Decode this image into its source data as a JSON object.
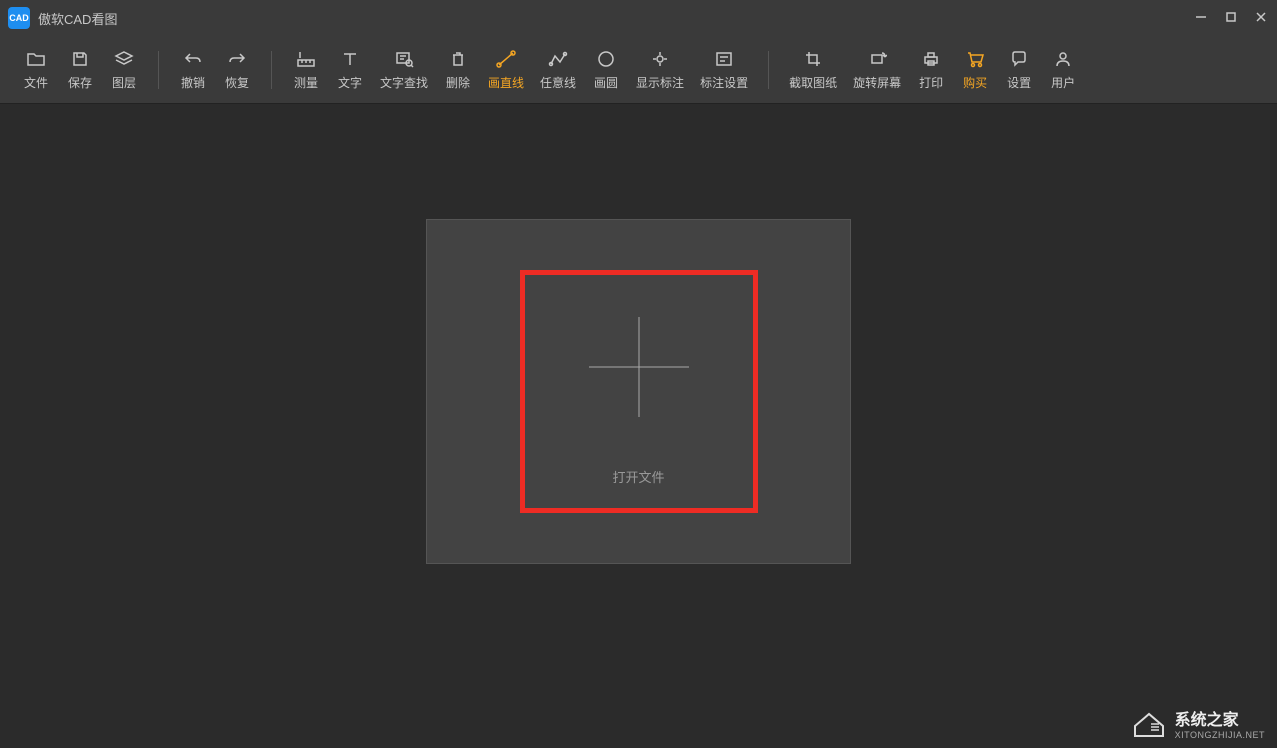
{
  "app": {
    "title": "傲软CAD看图",
    "icon_text": "CAD"
  },
  "toolbar": {
    "file": "文件",
    "save": "保存",
    "layers": "图层",
    "undo": "撤销",
    "redo": "恢复",
    "measure": "测量",
    "text": "文字",
    "text_search": "文字查找",
    "delete": "删除",
    "line": "画直线",
    "polyline": "任意线",
    "circle": "画圆",
    "show_annotations": "显示标注",
    "annotation_settings": "标注设置",
    "crop": "截取图纸",
    "rotate": "旋转屏幕",
    "print": "打印",
    "purchase": "购买",
    "settings": "设置",
    "user": "用户"
  },
  "canvas": {
    "open_file": "打开文件"
  },
  "watermark": {
    "main": "系统之家",
    "sub": "XITONGZHIJIA.NET"
  }
}
